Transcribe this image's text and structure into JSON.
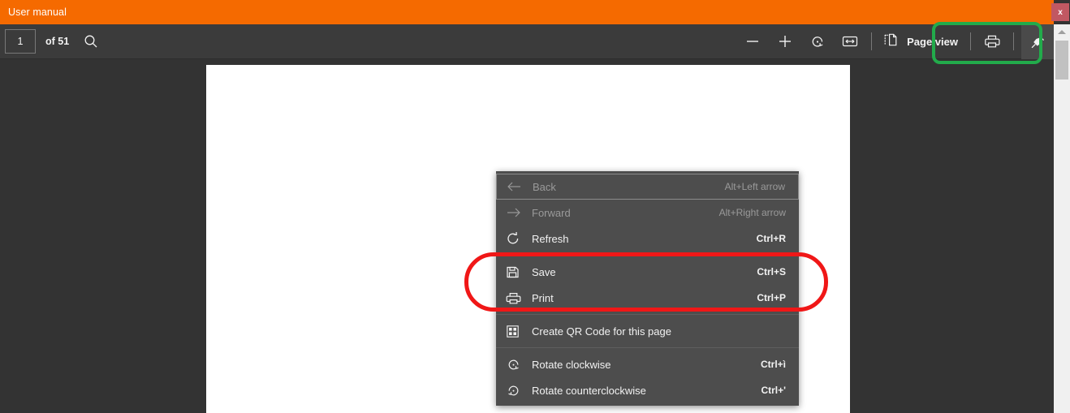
{
  "window": {
    "title": "User manual",
    "close_label": "x",
    "titlebar_color": "#f56a00"
  },
  "toolbar": {
    "page_number": "1",
    "page_total_label": "of 51",
    "search_icon": "search-icon",
    "zoom_out_icon": "minus-icon",
    "zoom_in_icon": "plus-icon",
    "rotate_icon": "rotate-clockwise-icon",
    "fit_width_icon": "fit-to-width-icon",
    "page_view_icon": "page-view-icon",
    "page_view_label": "Page view",
    "print_icon": "printer-icon",
    "pin_icon": "pin-icon"
  },
  "scrollbar": {
    "up_arrow_icon": "scroll-up-arrow-icon"
  },
  "context_menu": {
    "items": [
      {
        "label": "Back",
        "accel": "Alt+Left arrow",
        "icon": "arrow-left-icon",
        "disabled": true,
        "focused": true
      },
      {
        "label": "Forward",
        "accel": "Alt+Right arrow",
        "icon": "arrow-right-icon",
        "disabled": true,
        "focused": false
      },
      {
        "label": "Refresh",
        "accel": "Ctrl+R",
        "icon": "refresh-icon",
        "disabled": false,
        "focused": false
      },
      {
        "label": "Save",
        "accel": "Ctrl+S",
        "icon": "save-floppy-icon",
        "disabled": false,
        "focused": false
      },
      {
        "label": "Print",
        "accel": "Ctrl+P",
        "icon": "printer-icon",
        "disabled": false,
        "focused": false
      },
      {
        "label": "Create QR Code for this page",
        "accel": "",
        "icon": "qr-code-icon",
        "disabled": false,
        "focused": false
      },
      {
        "label": "Rotate clockwise",
        "accel": "Ctrl+ì",
        "icon": "rotate-clockwise-icon",
        "disabled": false,
        "focused": false
      },
      {
        "label": "Rotate counterclockwise",
        "accel": "Ctrl+'",
        "icon": "rotate-counterclockwise-icon",
        "disabled": false,
        "focused": false
      }
    ]
  },
  "annotations": {
    "green_highlight_color": "#22ab4b",
    "red_highlight_color": "#f01717"
  }
}
